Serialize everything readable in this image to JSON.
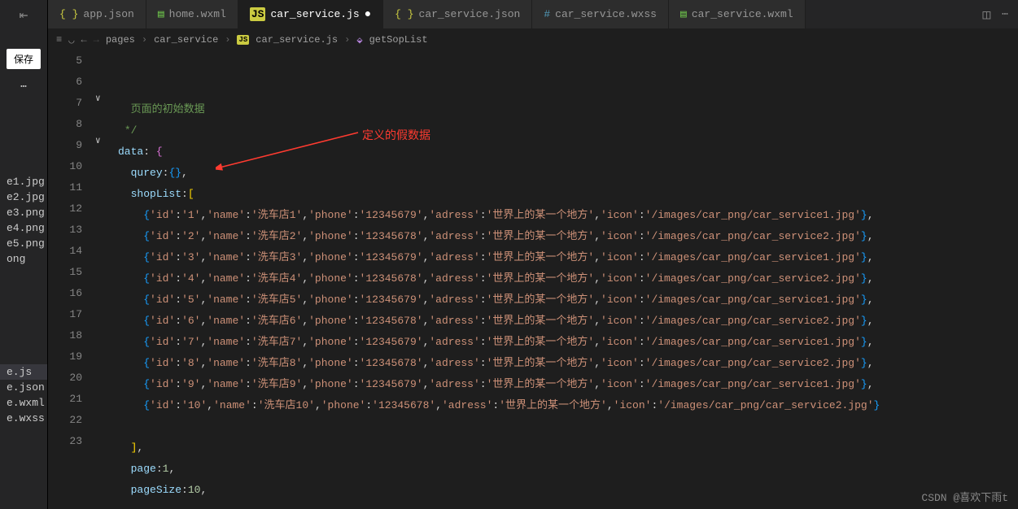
{
  "activity": {
    "save_label": "保存"
  },
  "explorer": {
    "files": [
      "e1.jpg",
      "e2.jpg",
      "e3.png",
      "e4.png",
      "e5.png",
      "ong"
    ],
    "files2": [
      "e.js",
      "e.json",
      "e.wxml",
      "e.wxss"
    ]
  },
  "tabs": [
    {
      "label": "app.json",
      "kind": "json"
    },
    {
      "label": "home.wxml",
      "kind": "wxml"
    },
    {
      "label": "car_service.js",
      "kind": "js",
      "active": true,
      "dirty": true
    },
    {
      "label": "car_service.json",
      "kind": "json"
    },
    {
      "label": "car_service.wxss",
      "kind": "wxss"
    },
    {
      "label": "car_service.wxml",
      "kind": "wxml"
    }
  ],
  "breadcrumbs": {
    "p1": "pages",
    "p2": "car_service",
    "p3": "car_service.js",
    "p4": "getSopList"
  },
  "annotation": "定义的假数据",
  "watermark": "CSDN @喜欢下雨t",
  "code": {
    "line_numbers": [
      "5",
      "6",
      "7",
      "8",
      "9",
      "10",
      "11",
      "12",
      "13",
      "14",
      "15",
      "16",
      "17",
      "18",
      "19",
      "20",
      "21",
      "22",
      "23"
    ],
    "partial_comment_top": "页面的初始数据",
    "comment_end": "*/",
    "data_label": "data",
    "qurey_label": "qurey",
    "shopList_label": "shopList",
    "page_label": "page",
    "page_value": "1",
    "pageSize_label": "pageSize",
    "pageSize_value": "10",
    "common_address": "世界上的某一个地方",
    "key_id": "id",
    "key_name": "name",
    "key_phone": "phone",
    "key_adress": "adress",
    "key_icon": "icon",
    "rows": [
      {
        "id": "1",
        "name": "洗车店1",
        "phone": "12345679",
        "icon": "/images/car_png/car_service1.jpg"
      },
      {
        "id": "2",
        "name": "洗车店2",
        "phone": "12345678",
        "icon": "/images/car_png/car_service2.jpg"
      },
      {
        "id": "3",
        "name": "洗车店3",
        "phone": "12345679",
        "icon": "/images/car_png/car_service1.jpg"
      },
      {
        "id": "4",
        "name": "洗车店4",
        "phone": "12345678",
        "icon": "/images/car_png/car_service2.jpg"
      },
      {
        "id": "5",
        "name": "洗车店5",
        "phone": "12345679",
        "icon": "/images/car_png/car_service1.jpg"
      },
      {
        "id": "6",
        "name": "洗车店6",
        "phone": "12345678",
        "icon": "/images/car_png/car_service2.jpg"
      },
      {
        "id": "7",
        "name": "洗车店7",
        "phone": "12345679",
        "icon": "/images/car_png/car_service1.jpg"
      },
      {
        "id": "8",
        "name": "洗车店8",
        "phone": "12345678",
        "icon": "/images/car_png/car_service2.jpg"
      },
      {
        "id": "9",
        "name": "洗车店9",
        "phone": "12345679",
        "icon": "/images/car_png/car_service1.jpg"
      },
      {
        "id": "10",
        "name": "洗车店10",
        "phone": "12345678",
        "icon": "/images/car_png/car_service2.jpg"
      }
    ]
  }
}
